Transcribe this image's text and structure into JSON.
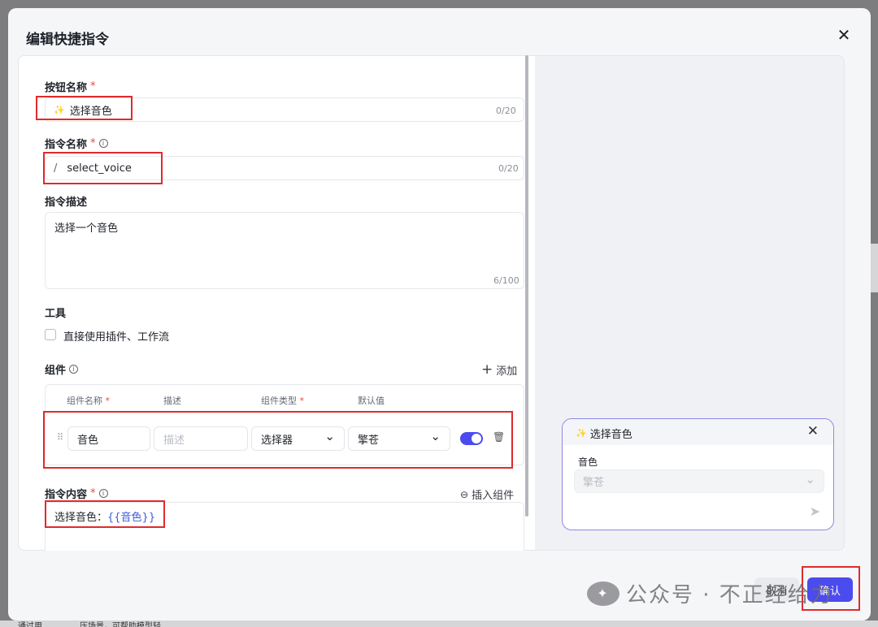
{
  "background": {
    "snippets": [
      "通过用",
      "压场景，可帮助模型轻"
    ]
  },
  "modal": {
    "title": "编辑快捷指令",
    "close_glyph": "✕"
  },
  "form": {
    "button_name": {
      "label": "按钮名称",
      "required": "*",
      "icon": "✨",
      "value": "选择音色",
      "counter": "0/20"
    },
    "command_name": {
      "label": "指令名称",
      "required": "*",
      "info": "i",
      "prefix": "/",
      "value": "select_voice",
      "counter": "0/20"
    },
    "command_desc": {
      "label": "指令描述",
      "value": "选择一个音色",
      "counter": "6/100"
    },
    "tools": {
      "label": "工具",
      "checkbox_label": "直接使用插件、工作流"
    },
    "components": {
      "label": "组件",
      "info": "i",
      "add_label": "添加",
      "add_glyph": "+",
      "headers": {
        "name": "组件名称",
        "name_req": "*",
        "desc": "描述",
        "type": "组件类型",
        "type_req": "*",
        "default": "默认值"
      },
      "row": {
        "drag": "⠿",
        "name": "音色",
        "desc_placeholder": "描述",
        "type": "选择器",
        "default": "擎苍",
        "chevron": "⌄",
        "delete_glyph": "🗑"
      }
    },
    "command_content": {
      "label": "指令内容",
      "required": "*",
      "info": "i",
      "insert_label": "插入组件",
      "insert_glyph": "⊖",
      "text_prefix": "选择音色：",
      "variable": "{{音色}}"
    }
  },
  "preview": {
    "title": "选择音色",
    "icon": "✨",
    "close_glyph": "✕",
    "field_label": "音色",
    "select_value": "擎苍",
    "chevron": "⌄",
    "send_glyph": "➤"
  },
  "footer": {
    "cancel_label": "取消",
    "confirm_label": "确认"
  },
  "watermark": {
    "logo": "✦",
    "text": "公众号 · 不正经给力"
  },
  "colors": {
    "accent": "#4b4bee",
    "required": "#e5483d",
    "highlight_box": "#e02b2b",
    "variable": "#3b5bdb"
  }
}
